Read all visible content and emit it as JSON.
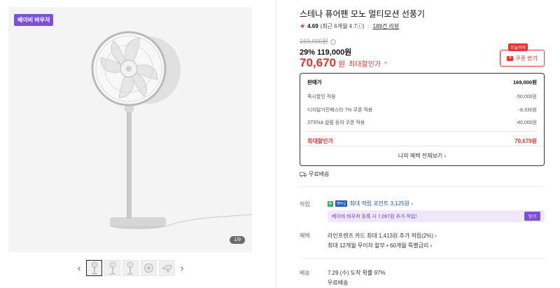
{
  "gallery": {
    "badge": "베이비 바우저",
    "counter": "1/9",
    "prev_label": "‹",
    "next_label": "›"
  },
  "product": {
    "title": "스테나 퓨어팬 모노 멀티모션 선풍기",
    "rating": {
      "score": "4.69",
      "recent": "(최근 6개월 4.7",
      "recent_icon": "ⓘ",
      "recent_close": ")",
      "reviews": "189건 리뷰"
    },
    "original_price": "169,000원",
    "discount_percent": "29%",
    "sale_price": "119,000원",
    "max_price_number": "70,670",
    "max_price_unit": "원",
    "max_price_label": "최대할인가",
    "max_price_chevron": "⌃"
  },
  "coupon": {
    "tag": "오늘까지",
    "icon": "쿠",
    "label": "쿠폰 받기"
  },
  "breakdown": {
    "head": {
      "label": "판매가",
      "value": "169,000원"
    },
    "rows": [
      {
        "label": "즉시할인 적용",
        "value": "-50,000원"
      },
      {
        "label": "디지털가전페스타 7% 쿠폰 적용",
        "value": "-8,330원"
      },
      {
        "label": "STENA 컬럼 등의 쿠폰 적용",
        "value": "-40,000원"
      }
    ],
    "total": {
      "label": "최대할인가",
      "value": "70,670원"
    },
    "more": "나의 혜택 전체보기 ›"
  },
  "shipping_free": "무료배송",
  "points": {
    "label": "적립",
    "n_badge": "N",
    "up_badge": "멤버십",
    "text": "최대 적립 포인트 3,125원 ›",
    "promo": "베이비 바우저 등록 시 7,067원 추가 적립!",
    "promo_button": "받기"
  },
  "benefits": {
    "label": "혜택",
    "line1": "라인프렌즈 카드 최대 1,413원 추가 적립(2%) ›",
    "line2": "최대 12개월 무이자 할부 • 60개월 특별금리 ›"
  },
  "delivery": {
    "label": "배송",
    "line1": "7.29 (수) 도착 확률 97%",
    "line2": "무료배송"
  },
  "colors": {
    "accent_red": "#e8322d",
    "purple": "#7a50d8",
    "link_blue": "#1a56c8"
  }
}
